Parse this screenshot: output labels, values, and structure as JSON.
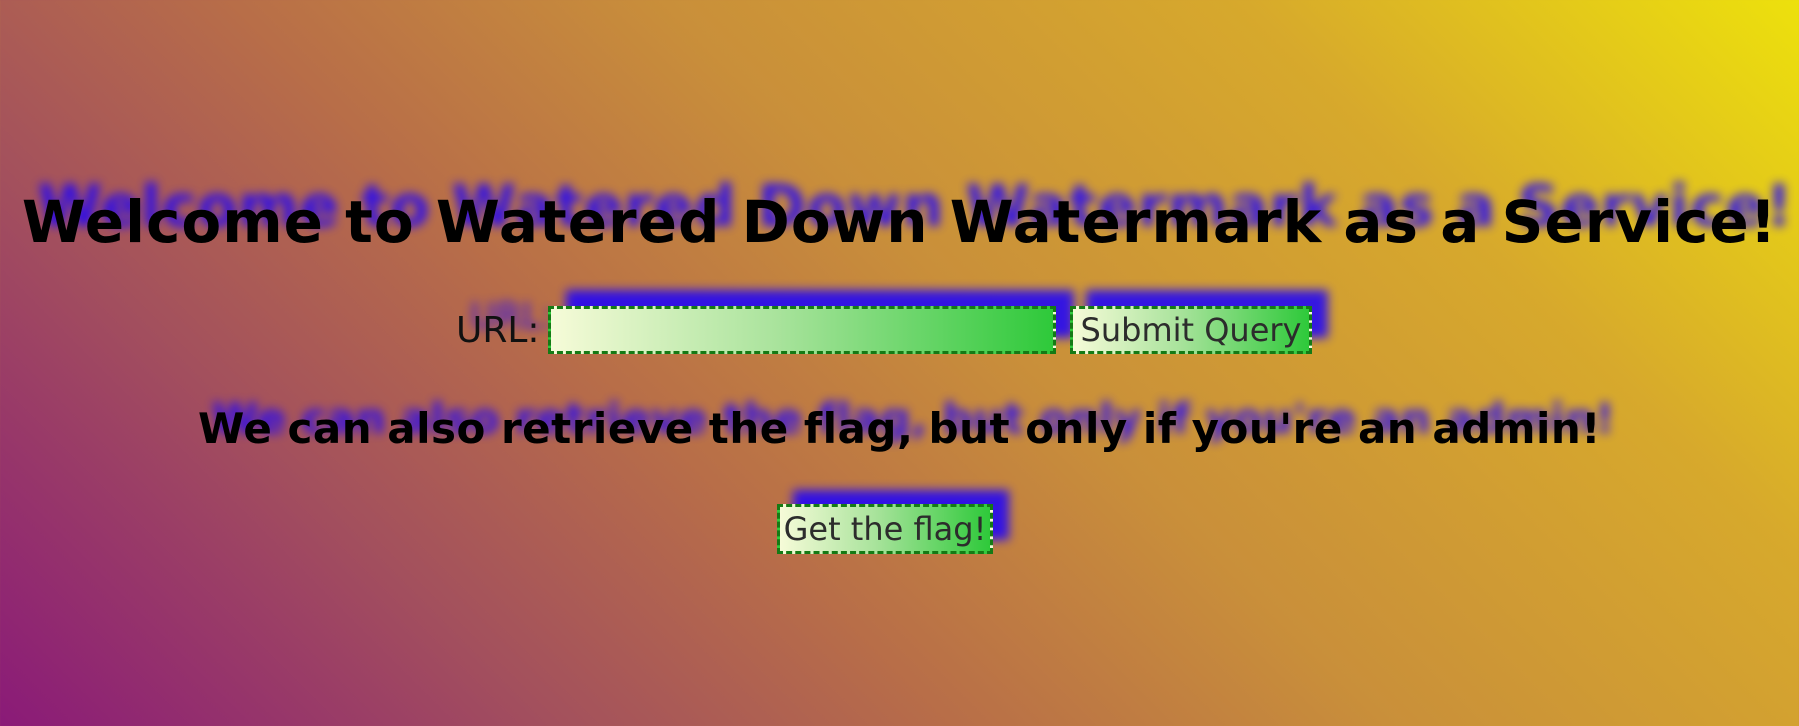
{
  "page": {
    "heading": "Welcome to Watered Down Watermark as a Service!",
    "subheading": "We can also retrieve the flag, but only if you're an admin!"
  },
  "form": {
    "url_label": "URL:",
    "url_value": "",
    "submit_label": "Submit Query"
  },
  "flag": {
    "button_label": "Get the flag!"
  },
  "colors": {
    "text": "#000000",
    "watermark": "#1a00ff",
    "button_border": "#157a15",
    "button_gradient_start": "#f6fbd8",
    "button_gradient_end": "#2ec93a",
    "background_corner_purple": "#8a1a78",
    "background_corner_yellow": "#ede10c"
  }
}
